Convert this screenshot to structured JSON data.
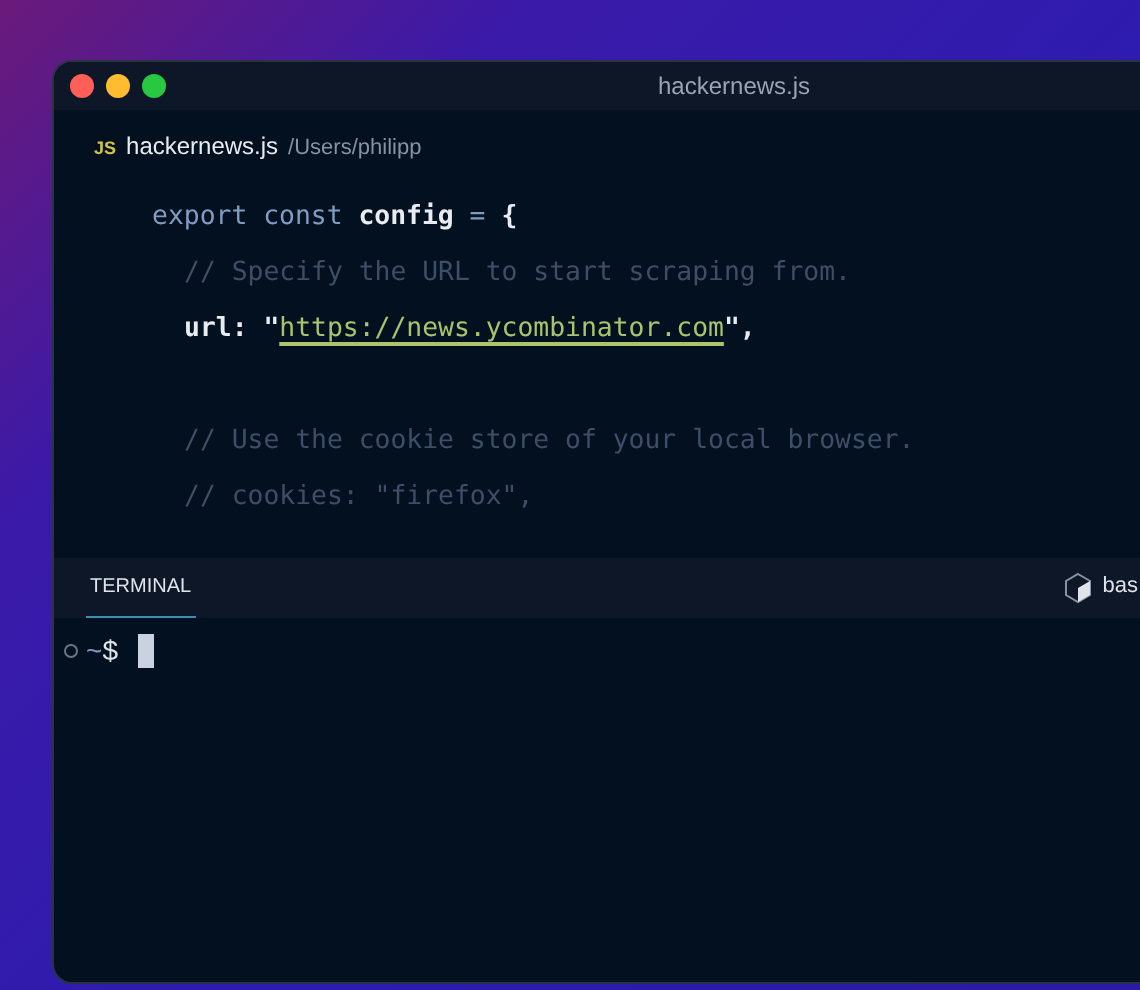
{
  "window": {
    "title": "hackernews.js"
  },
  "file_tab": {
    "icon_label": "JS",
    "name": "hackernews.js",
    "path": "/Users/philipp"
  },
  "code_lines": [
    {
      "kind": "code",
      "tokens": [
        {
          "text": "export",
          "kind": "keyword"
        },
        {
          "text": " const",
          "kind": "keyword"
        },
        {
          "text": " config",
          "kind": "ident"
        },
        {
          "text": " =",
          "kind": "operator"
        },
        {
          "text": " {",
          "kind": "ident"
        }
      ],
      "children": [
        {
          "kind": "code",
          "tokens": [
            {
              "text": "// Specify the URL to start scraping from.",
              "kind": "comment"
            }
          ]
        },
        {
          "kind": "code",
          "tokens": [
            {
              "text": "url: \"",
              "kind": "ident"
            },
            {
              "text": "https://news.ycombinator.com",
              "kind": "link"
            },
            {
              "text": "\",",
              "kind": "ident"
            }
          ]
        },
        {
          "kind": "blank"
        },
        {
          "kind": "code",
          "tokens": [
            {
              "text": "// Use the cookie store of your local browser.",
              "kind": "comment"
            }
          ]
        },
        {
          "kind": "code",
          "tokens": [
            {
              "text": "// cookies: \"firefox\",",
              "kind": "comment"
            }
          ]
        }
      ]
    }
  ],
  "panel": {
    "tabs": [
      {
        "label": "TERMINAL",
        "selected": true
      }
    ],
    "shell": "bas"
  },
  "terminal": {
    "prompt": "~$"
  }
}
